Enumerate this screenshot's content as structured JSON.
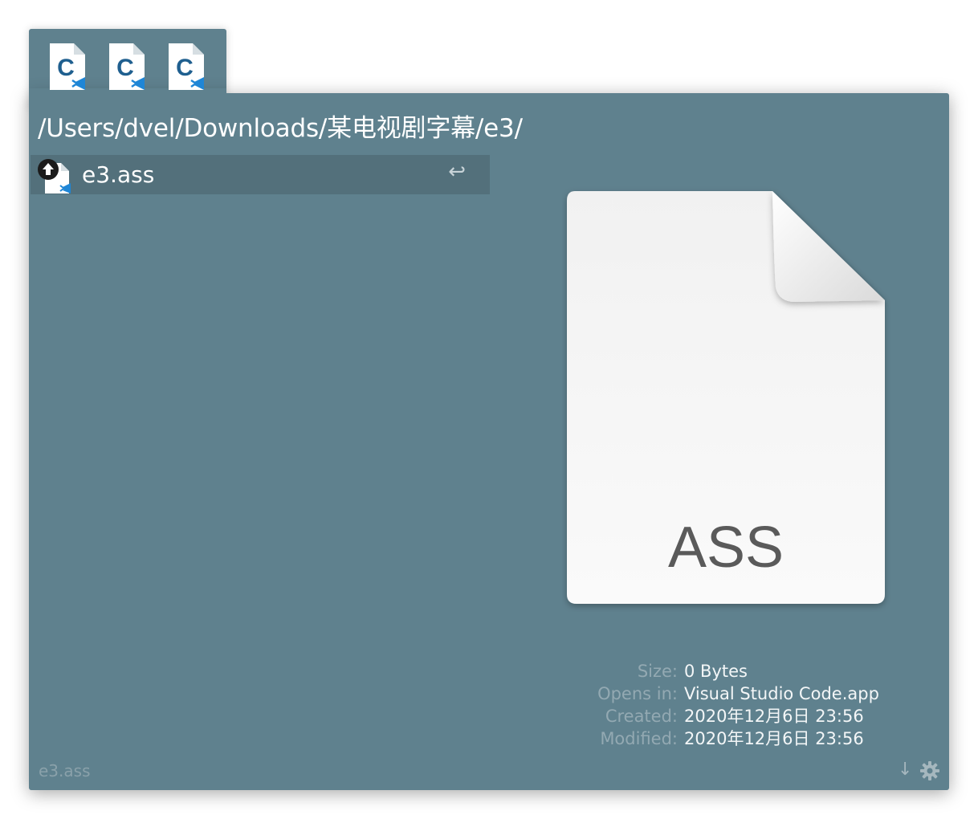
{
  "stack": {
    "files": [
      {
        "icon": "c-source-vscode-file-icon",
        "letter": "C"
      },
      {
        "icon": "c-source-vscode-file-icon",
        "letter": "C"
      },
      {
        "icon": "c-source-vscode-file-icon",
        "letter": "C"
      }
    ]
  },
  "path": "/Users/dvel/Downloads/某电视剧字幕/e3/",
  "results": [
    {
      "label": "e3.ass",
      "return_glyph": "↩",
      "icon": "ass-file-icon",
      "badge": "up-arrow-badge-icon"
    }
  ],
  "preview": {
    "extension": "ASS",
    "icon": "generic-document-icon"
  },
  "info": {
    "size_label": "Size:",
    "size_value": "0 Bytes",
    "opens_label": "Opens in:",
    "opens_value": "Visual Studio Code.app",
    "created_label": "Created:",
    "created_value": "2020年12月6日 23:56",
    "modified_label": "Modified:",
    "modified_value": "2020年12月6日 23:56"
  },
  "footer": {
    "selected_name": "e3.ass",
    "sort_glyph": "↓",
    "settings_icon": "gear-icon"
  },
  "colors": {
    "panel": "#5f818e",
    "selection": "#53707b",
    "vscode_blue": "#1f86d6"
  }
}
